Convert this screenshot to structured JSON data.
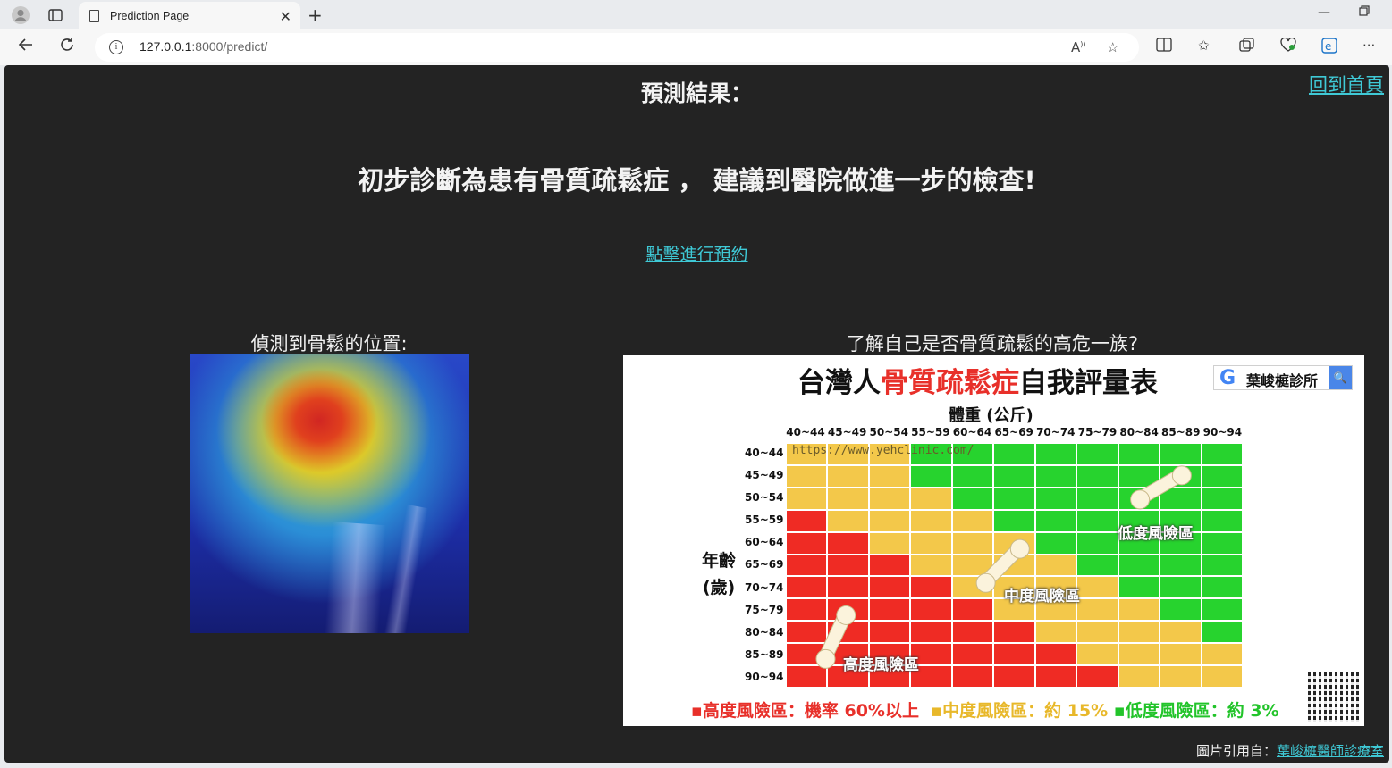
{
  "browser": {
    "tab_title": "Prediction Page",
    "url_host": "127.0.0.1",
    "url_path": ":8000/predict/"
  },
  "page": {
    "home_link": "回到首頁",
    "title": "預測結果：",
    "diagnosis": "初步診斷為患有骨質疏鬆症 ， 建議到醫院做進一步的檢查!",
    "appointment_link": "點擊進行預約",
    "left_caption": "偵測到骨鬆的位置:",
    "right_caption": "了解自己是否骨質疏鬆的高危一族?",
    "credit_prefix": "圖片引用自：",
    "credit_link": "葉峻榳醫師診療室"
  },
  "risk_chart": {
    "title_prefix": "台灣人",
    "title_highlight": "骨質疏鬆症",
    "title_suffix": "自我評量表",
    "search_badge": "葉峻榳診所",
    "weight_label": "體重 (公斤)",
    "age_label_1": "年齡",
    "age_label_2": "(歲)",
    "watermark_url": "https://www.yehclinic.com/",
    "weight_ranges": [
      "40~44",
      "45~49",
      "50~54",
      "55~59",
      "60~64",
      "65~69",
      "70~74",
      "75~79",
      "80~84",
      "85~89",
      "90~94"
    ],
    "age_ranges": [
      "40~44",
      "45~49",
      "50~54",
      "55~59",
      "60~64",
      "65~69",
      "70~74",
      "75~79",
      "80~84",
      "85~89",
      "90~94"
    ],
    "risk_grid": [
      "MMMGGGGGGGG",
      "MMMGGGGGGGG",
      "MMMMGGGGGGG",
      "HMMMMGGGGGG",
      "HHMMMMGGGGG",
      "HHHMMMMGGGG",
      "HHHHMMMMGGG",
      "HHHHHMMMMGG",
      "HHHHHHMMMMG",
      "HHHHHHHMMMM",
      "HHHHHHHHMMM"
    ],
    "colors": {
      "H": "#ef2b24",
      "M": "#f3c84a",
      "G": "#27d32e"
    },
    "zone_low": "低度風險區",
    "zone_mid": "中度風險區",
    "zone_high": "高度風險區",
    "legend_high": "▪高度風險區：機率 60%以上",
    "legend_mid": "▪中度風險區：約 15%",
    "legend_low": "▪低度風險區：約 3%"
  }
}
